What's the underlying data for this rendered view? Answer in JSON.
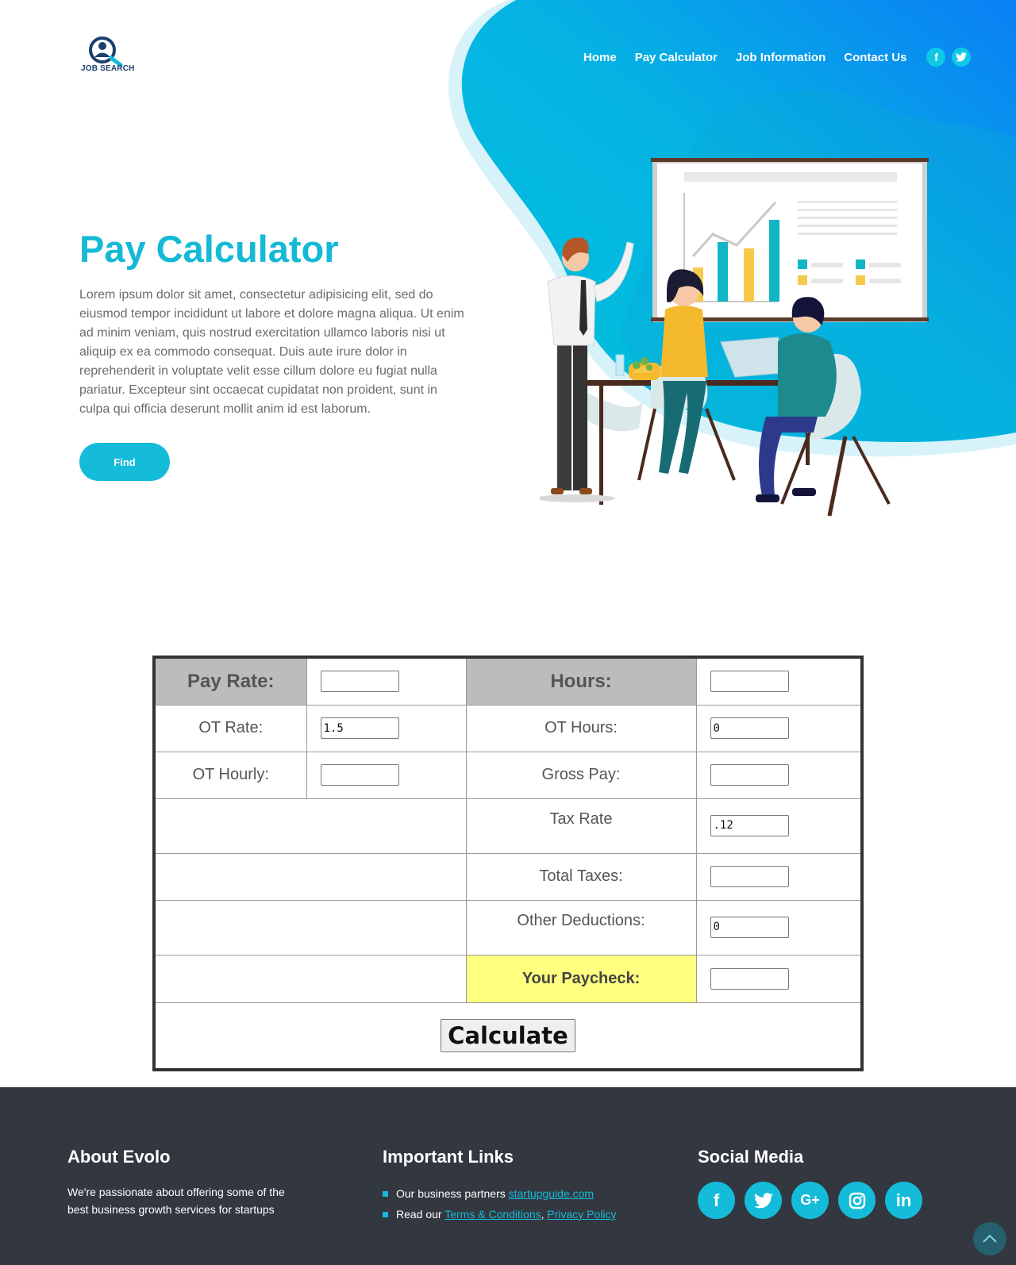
{
  "brand": {
    "logo_text": "JOB SEARCH",
    "accent": "#14bcd9"
  },
  "nav": {
    "items": [
      {
        "label": "Home"
      },
      {
        "label": "Pay Calculator"
      },
      {
        "label": "Job Information"
      },
      {
        "label": "Contact Us"
      }
    ],
    "social": [
      {
        "icon": "facebook-icon",
        "glyph": "f"
      },
      {
        "icon": "twitter-icon",
        "glyph": "t"
      }
    ]
  },
  "hero": {
    "title": "Pay Calculator",
    "text": "Lorem ipsum dolor sit amet, consectetur adipisicing elit, sed do eiusmod tempor incididunt ut labore et dolore magna aliqua. Ut enim ad minim veniam, quis nostrud exercitation ullamco laboris nisi ut aliquip ex ea commodo consequat. Duis aute irure dolor in reprehenderit in voluptate velit esse cillum dolore eu fugiat nulla pariatur. Excepteur sint occaecat cupidatat non proident, sunt in culpa qui officia deserunt mollit anim id est laborum.",
    "button": "Find"
  },
  "calculator": {
    "pay_rate_label": "Pay Rate:",
    "pay_rate_value": "",
    "hours_label": "Hours:",
    "hours_value": "",
    "ot_rate_label": "OT Rate:",
    "ot_rate_value": "1.5",
    "ot_hours_label": "OT Hours:",
    "ot_hours_value": "0",
    "ot_hourly_label": "OT Hourly:",
    "ot_hourly_value": "",
    "gross_pay_label": "Gross Pay:",
    "gross_pay_value": "",
    "tax_rate_label": "Tax Rate",
    "tax_rate_value": ".12",
    "total_taxes_label": "Total Taxes:",
    "total_taxes_value": "",
    "other_deductions_label": "Other Deductions:",
    "other_deductions_value": "0",
    "paycheck_label": "Your Paycheck:",
    "paycheck_value": "",
    "calculate_button": "Calculate",
    "colors": {
      "header_cell": "#bcbcbc",
      "paycheck_cell": "#ffff80"
    }
  },
  "footer": {
    "about": {
      "title": "About Evolo",
      "text": "We're passionate about offering some of the best business growth services for startups"
    },
    "links": {
      "title": "Important Links",
      "partners_prefix": "Our business partners ",
      "partners_link": "startupguide.com",
      "read_prefix": "Read our ",
      "terms_link": "Terms & Conditions",
      "separator": ", ",
      "privacy_link": "Privacy Policy"
    },
    "social": {
      "title": "Social Media",
      "icons": [
        {
          "icon": "facebook-icon",
          "glyph": "f"
        },
        {
          "icon": "twitter-icon",
          "glyph": "t"
        },
        {
          "icon": "google-plus-icon",
          "glyph": "G+"
        },
        {
          "icon": "instagram-icon",
          "glyph": "◎"
        },
        {
          "icon": "linkedin-icon",
          "glyph": "in"
        }
      ]
    }
  },
  "back_to_top": {
    "icon": "chevron-up-icon",
    "glyph": "︿"
  }
}
